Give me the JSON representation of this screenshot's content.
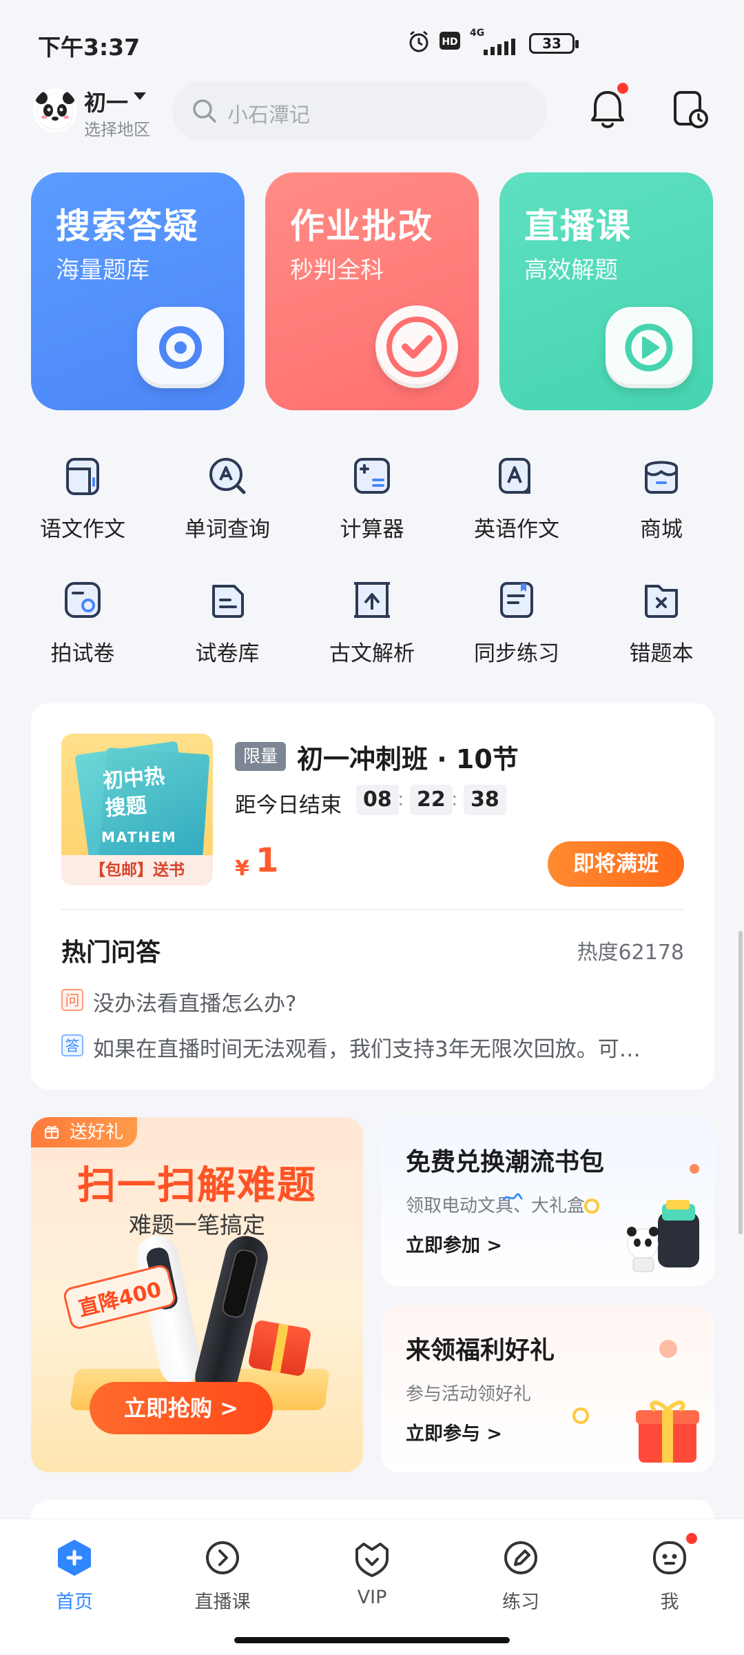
{
  "status": {
    "time": "下午3:37",
    "network": "4G",
    "battery": "33"
  },
  "header": {
    "grade": "初一",
    "region_hint": "选择地区",
    "search_placeholder": "小石潭记"
  },
  "feature_cards": [
    {
      "title": "搜索答疑",
      "subtitle": "海量题库",
      "icon": "camera-icon",
      "color": "#5b9cff"
    },
    {
      "title": "作业批改",
      "subtitle": "秒判全科",
      "icon": "check-icon",
      "color": "#ff7a76"
    },
    {
      "title": "直播课",
      "subtitle": "高效解题",
      "icon": "play-icon",
      "color": "#4fd9b8"
    }
  ],
  "tools": [
    {
      "label": "语文作文",
      "icon": "chinese-essay-icon"
    },
    {
      "label": "单词查询",
      "icon": "word-lookup-icon"
    },
    {
      "label": "计算器",
      "icon": "calculator-icon"
    },
    {
      "label": "英语作文",
      "icon": "english-essay-icon"
    },
    {
      "label": "商城",
      "icon": "shop-icon"
    },
    {
      "label": "拍试卷",
      "icon": "scan-paper-icon"
    },
    {
      "label": "试卷库",
      "icon": "paper-library-icon"
    },
    {
      "label": "古文解析",
      "icon": "classical-text-icon"
    },
    {
      "label": "同步练习",
      "icon": "sync-practice-icon"
    },
    {
      "label": "错题本",
      "icon": "mistake-book-icon"
    }
  ],
  "course": {
    "book_title": "初中热搜题",
    "book_subtitle": "MATHEM",
    "book_badge": "【包邮】送书",
    "limit_tag": "限量",
    "title": "初一冲刺班 · 10节",
    "countdown_label": "距今日结束",
    "countdown": {
      "h": "08",
      "m": "22",
      "s": "38"
    },
    "price_symbol": "¥",
    "price": "1",
    "cta": "即将满班"
  },
  "hot_qa": {
    "title": "热门问答",
    "heat": "热度62178",
    "q_tag": "问",
    "a_tag": "答",
    "question": "没办法看直播怎么办?",
    "answer": "如果在直播时间无法观看，我们支持3年无限次回放。可…"
  },
  "promo_left": {
    "tag": "送好礼",
    "title": "扫一扫解难题",
    "subtitle": "难题一笔搞定",
    "badge": "直降400",
    "cta": "立即抢购 >"
  },
  "promo_right": [
    {
      "title": "免费兑换潮流书包",
      "subtitle": "领取电动文具、大礼盒",
      "link": "立即参加 >"
    },
    {
      "title": "来领福利好礼",
      "subtitle": "参与活动领好礼",
      "link": "立即参与 >"
    }
  ],
  "tabbar": [
    {
      "label": "首页",
      "icon": "home-plus-icon",
      "active": true
    },
    {
      "label": "直播课",
      "icon": "live-class-icon"
    },
    {
      "label": "VIP",
      "icon": "vip-icon"
    },
    {
      "label": "练习",
      "icon": "practice-pen-icon"
    },
    {
      "label": "我",
      "icon": "profile-face-icon"
    }
  ]
}
